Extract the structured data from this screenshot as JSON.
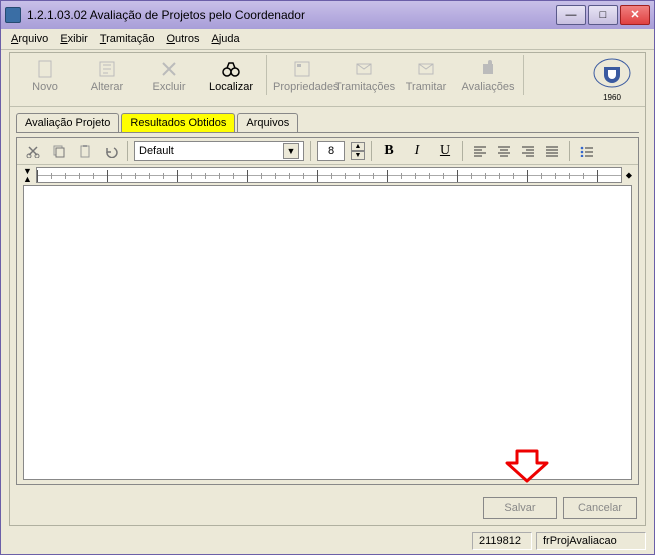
{
  "window": {
    "title": "1.2.1.03.02 Avaliação de Projetos pelo Coordenador"
  },
  "menu": {
    "arquivo": "Arquivo",
    "exibir": "Exibir",
    "tramitacao": "Tramitação",
    "outros": "Outros",
    "ajuda": "Ajuda"
  },
  "toolbar": {
    "novo": "Novo",
    "alterar": "Alterar",
    "excluir": "Excluir",
    "localizar": "Localizar",
    "propriedades": "Propriedades",
    "tramitacoes": "Tramitações",
    "tramitar": "Tramitar",
    "avaliacoes": "Avaliações",
    "logo_year": "1960"
  },
  "tabs": {
    "avaliacao_projeto": "Avaliação Projeto",
    "resultados_obtidos": "Resultados Obtidos",
    "arquivos": "Arquivos"
  },
  "editor": {
    "font_name": "Default",
    "font_size": "8",
    "bold": "B",
    "italic": "I",
    "underline": "U"
  },
  "buttons": {
    "salvar": "Salvar",
    "cancelar": "Cancelar"
  },
  "status": {
    "code": "2119812",
    "form": "frProjAvaliacao"
  }
}
